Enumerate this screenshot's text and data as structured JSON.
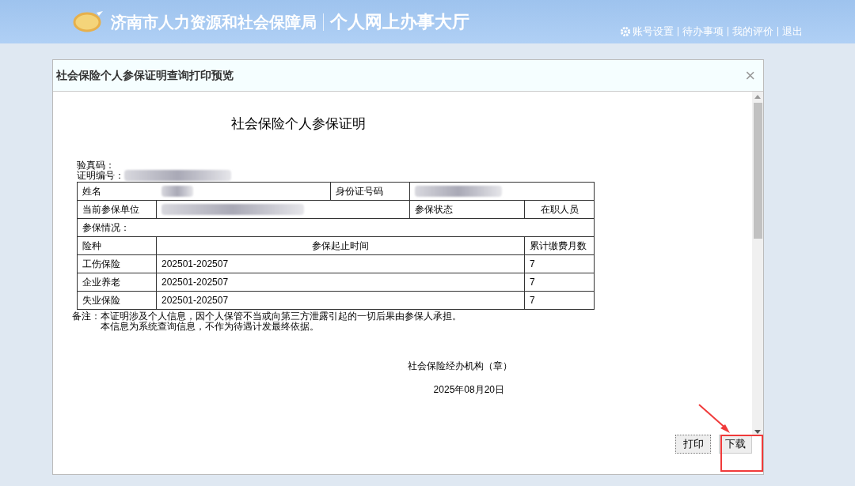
{
  "header": {
    "title_org": "济南市人力资源和社会保障局",
    "title_hall": "个人网上办事大厅",
    "links": [
      "账号设置",
      "待办事项",
      "我的评价",
      "退出"
    ]
  },
  "dialog": {
    "title": "社会保险个人参保证明查询打印预览",
    "close": "×",
    "document": {
      "heading": "社会保险个人参保证明",
      "verify_label": "验真码：",
      "cert_no_label": "证明编号：",
      "name_label": "姓名",
      "id_label": "身份证号码",
      "unit_label": "当前参保单位",
      "status_label": "参保状态",
      "status_value": "在职人员",
      "section_label": "参保情况：",
      "columns": [
        "险种",
        "参保起止时间",
        "累计缴费月数"
      ],
      "rows": [
        {
          "type": "工伤保险",
          "period": "202501-202507",
          "months": "7"
        },
        {
          "type": "企业养老",
          "period": "202501-202507",
          "months": "7"
        },
        {
          "type": "失业保险",
          "period": "202501-202507",
          "months": "7"
        }
      ],
      "note_label": "备注：",
      "notes": [
        "本证明涉及个人信息，因个人保管不当或向第三方泄露引起的一切后果由参保人承担。",
        "本信息为系统查询信息，不作为待遇计发最终依据。"
      ],
      "issuer": "社会保险经办机构（章）",
      "date": "2025年08月20日"
    },
    "buttons": [
      "打印",
      "下载"
    ]
  }
}
